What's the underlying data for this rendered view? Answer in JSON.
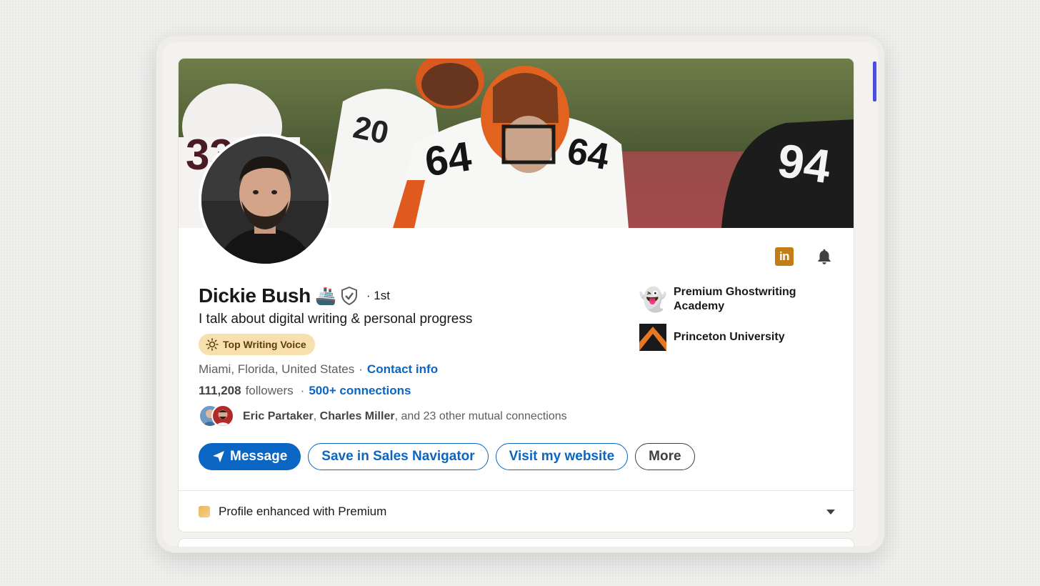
{
  "profile": {
    "name": "Dickie Bush",
    "name_emoji": "🚢",
    "verified_icon": "shield-check-icon",
    "degree": "· 1st",
    "headline": "I talk about digital writing & personal progress",
    "badge": "Top Writing Voice",
    "location": "Miami, Florida, United States",
    "location_sep": "·",
    "contact_info": "Contact info",
    "followers_count": "111,208",
    "followers_label": "followers",
    "connections_sep": "·",
    "connections": "500+ connections",
    "mutual": {
      "name1": "Eric Partaker",
      "sep": ",",
      "name2": "Charles Miller",
      "rest": ", and 23 other mutual connections"
    }
  },
  "banner": {
    "jersey_numbers": [
      "33",
      "20",
      "64",
      "64",
      "94"
    ]
  },
  "actions": {
    "message": "Message",
    "sales_navigator": "Save in Sales Navigator",
    "website": "Visit my website",
    "more": "More"
  },
  "organizations": [
    {
      "name": "Premium Ghostwriting Academy",
      "logo": "👻"
    },
    {
      "name": "Princeton University",
      "logo": "princeton-chevron"
    }
  ],
  "premium": {
    "label": "Profile enhanced with Premium"
  },
  "icons": {
    "linkedin": "in",
    "bell": "bell-icon"
  },
  "colors": {
    "link": "#0a66c2",
    "badge_bg": "#f8dfae",
    "linkedin_gold": "#c37d16",
    "princeton_orange": "#e87722"
  }
}
